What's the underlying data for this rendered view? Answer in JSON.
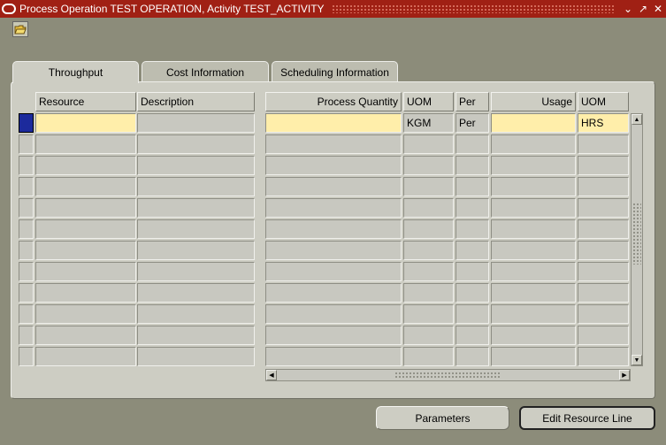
{
  "window": {
    "title": "Process Operation TEST OPERATION, Activity TEST_ACTIVITY",
    "minimize_glyph": "⌄",
    "maximize_glyph": "↗",
    "close_glyph": "✕"
  },
  "toolbar": {
    "open_icon": "folder-open-icon"
  },
  "tabs": [
    {
      "label": "Throughput",
      "active": true
    },
    {
      "label": "Cost Information",
      "active": false
    },
    {
      "label": "Scheduling Information",
      "active": false
    }
  ],
  "table": {
    "headers": {
      "resource": "Resource",
      "description": "Description",
      "process_quantity": "Process Quantity",
      "uom1": "UOM",
      "per": "Per",
      "usage": "Usage",
      "uom2": "UOM"
    },
    "rows": [
      {
        "resource": "",
        "description": "",
        "process_quantity": "",
        "uom1": "KGM",
        "per": "Per",
        "usage": "",
        "uom2": "HRS"
      },
      {
        "resource": "",
        "description": "",
        "process_quantity": "",
        "uom1": "",
        "per": "",
        "usage": "",
        "uom2": ""
      },
      {
        "resource": "",
        "description": "",
        "process_quantity": "",
        "uom1": "",
        "per": "",
        "usage": "",
        "uom2": ""
      },
      {
        "resource": "",
        "description": "",
        "process_quantity": "",
        "uom1": "",
        "per": "",
        "usage": "",
        "uom2": ""
      },
      {
        "resource": "",
        "description": "",
        "process_quantity": "",
        "uom1": "",
        "per": "",
        "usage": "",
        "uom2": ""
      },
      {
        "resource": "",
        "description": "",
        "process_quantity": "",
        "uom1": "",
        "per": "",
        "usage": "",
        "uom2": ""
      },
      {
        "resource": "",
        "description": "",
        "process_quantity": "",
        "uom1": "",
        "per": "",
        "usage": "",
        "uom2": ""
      },
      {
        "resource": "",
        "description": "",
        "process_quantity": "",
        "uom1": "",
        "per": "",
        "usage": "",
        "uom2": ""
      },
      {
        "resource": "",
        "description": "",
        "process_quantity": "",
        "uom1": "",
        "per": "",
        "usage": "",
        "uom2": ""
      },
      {
        "resource": "",
        "description": "",
        "process_quantity": "",
        "uom1": "",
        "per": "",
        "usage": "",
        "uom2": ""
      },
      {
        "resource": "",
        "description": "",
        "process_quantity": "",
        "uom1": "",
        "per": "",
        "usage": "",
        "uom2": ""
      },
      {
        "resource": "",
        "description": "",
        "process_quantity": "",
        "uom1": "",
        "per": "",
        "usage": "",
        "uom2": ""
      }
    ]
  },
  "buttons": {
    "parameters": "Parameters",
    "edit_resource_line": "Edit Resource Line"
  },
  "colors": {
    "background": "#8c8c7a",
    "titlebar": "#a02014",
    "panel": "#cdcdc3",
    "required_field": "#ffeeaa",
    "current_record": "#1c2a9c"
  }
}
